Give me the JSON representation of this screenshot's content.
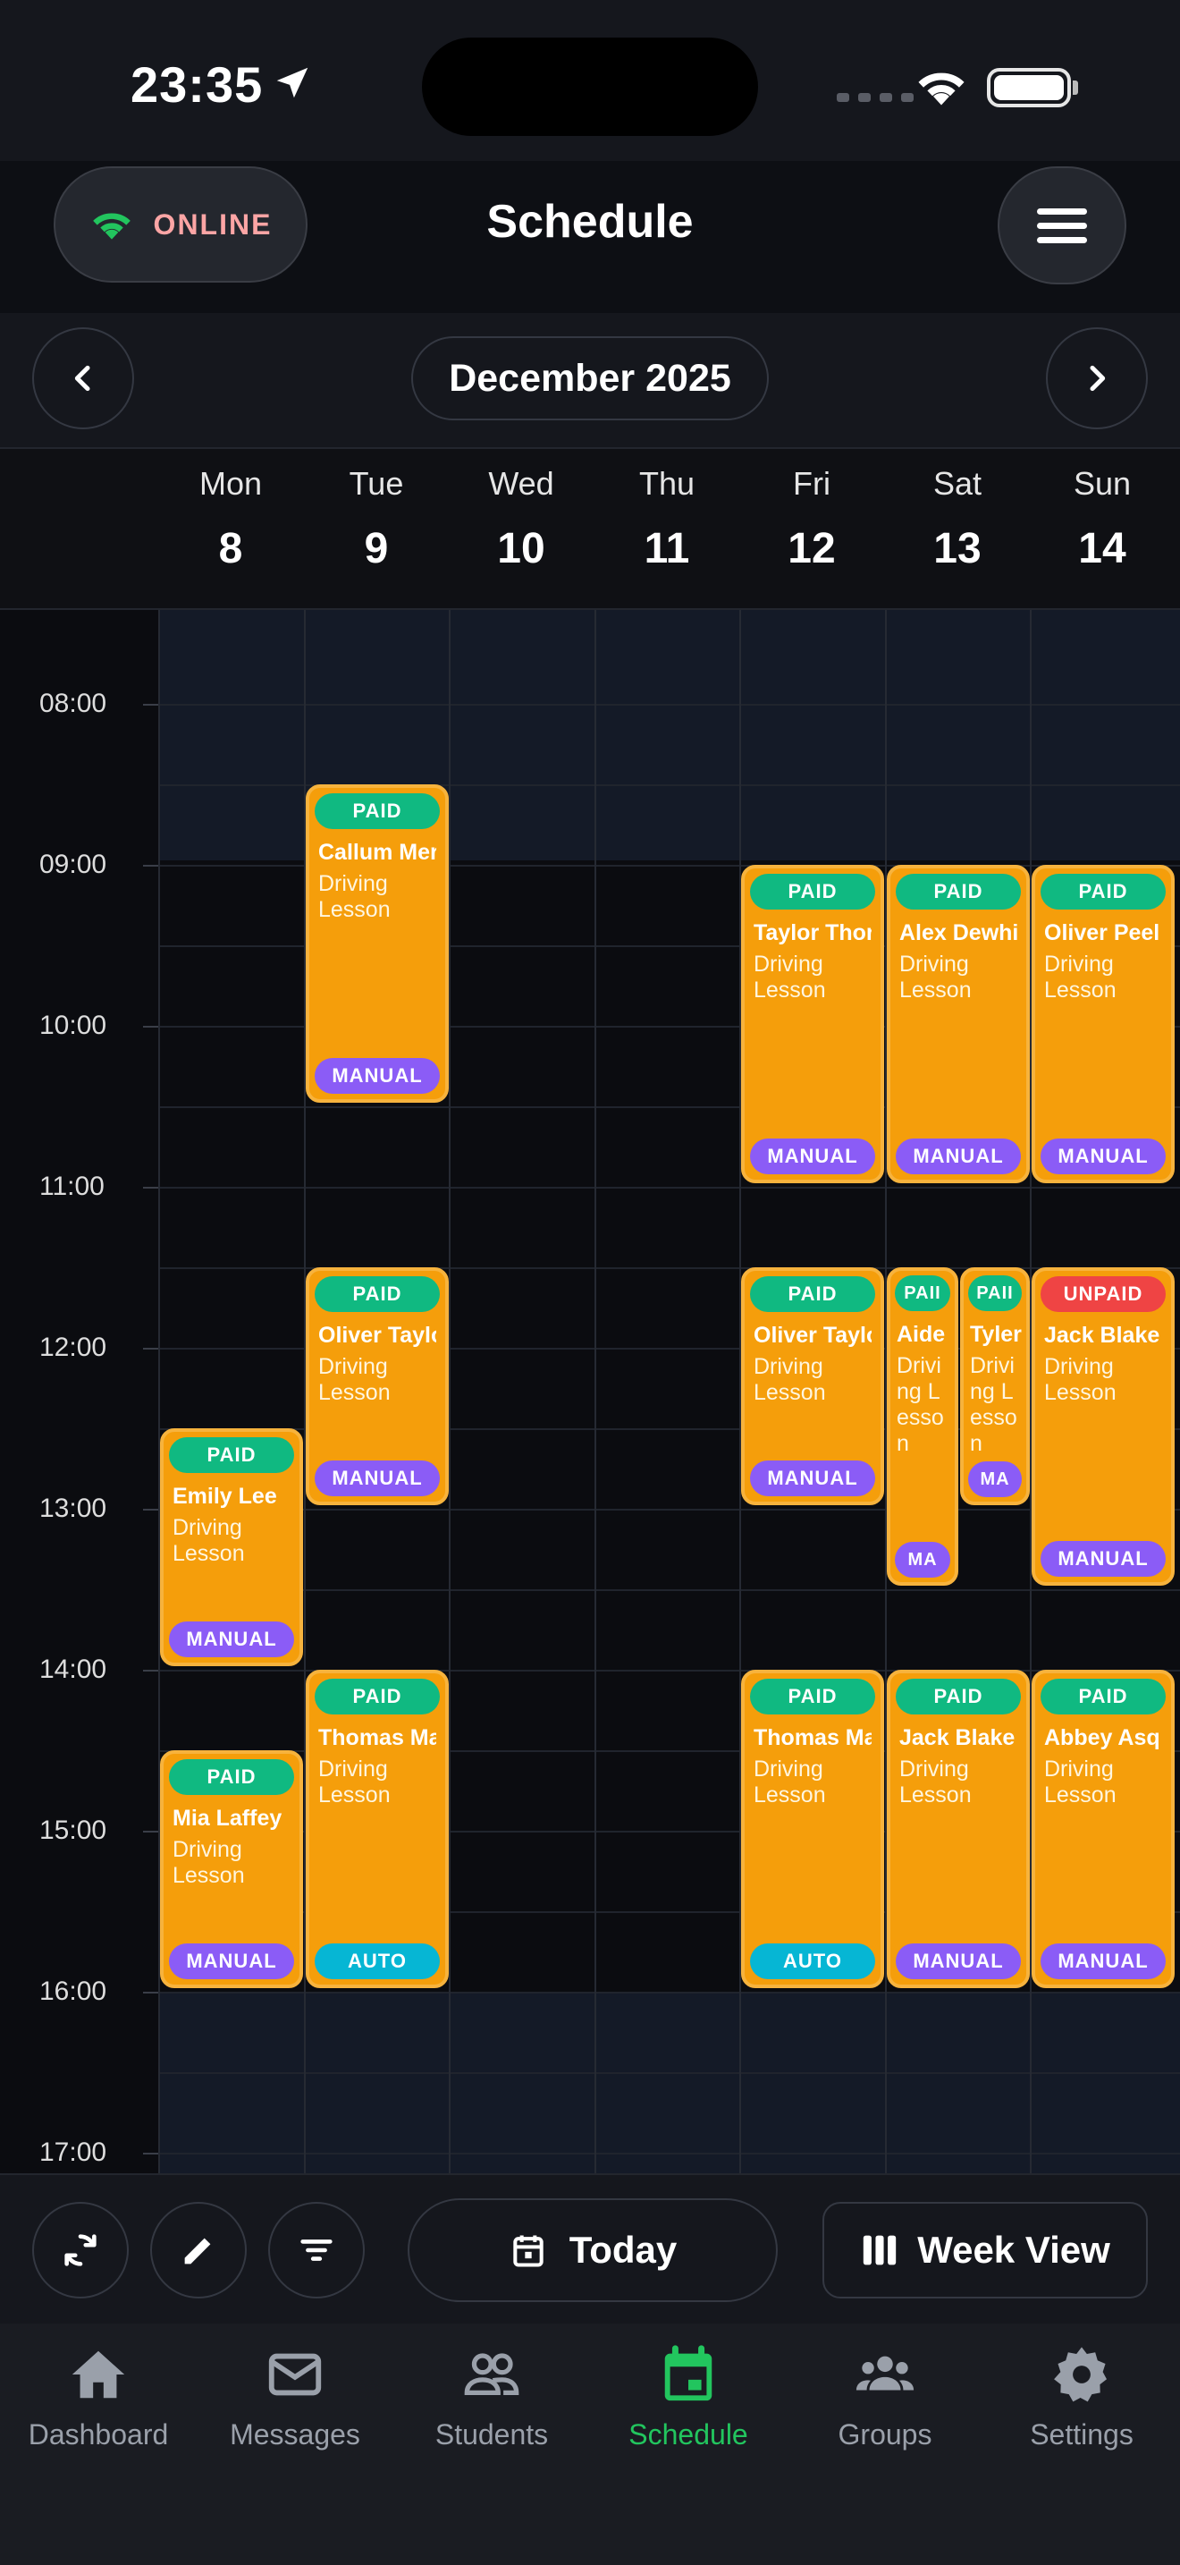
{
  "status_bar": {
    "time": "23:35"
  },
  "header": {
    "connection": "ONLINE",
    "title": "Schedule"
  },
  "month_nav": {
    "label": "December 2025"
  },
  "days": [
    {
      "name": "Mon",
      "num": "8"
    },
    {
      "name": "Tue",
      "num": "9"
    },
    {
      "name": "Wed",
      "num": "10"
    },
    {
      "name": "Thu",
      "num": "11"
    },
    {
      "name": "Fri",
      "num": "12"
    },
    {
      "name": "Sat",
      "num": "13"
    },
    {
      "name": "Sun",
      "num": "14"
    }
  ],
  "times": [
    "08:00",
    "09:00",
    "10:00",
    "11:00",
    "12:00",
    "13:00",
    "14:00",
    "15:00",
    "16:00",
    "17:00"
  ],
  "events": [
    {
      "name": "Callum Mer",
      "type": "Driving Lesson",
      "status": "PAID",
      "gear": "MANUAL"
    },
    {
      "name": "Taylor Thor",
      "type": "Driving Lesson",
      "status": "PAID",
      "gear": "MANUAL"
    },
    {
      "name": "Alex Dewhi",
      "type": "Driving Lesson",
      "status": "PAID",
      "gear": "MANUAL"
    },
    {
      "name": "Oliver Peel",
      "type": "Driving Lesson",
      "status": "PAID",
      "gear": "MANUAL"
    },
    {
      "name": "Oliver Taylo",
      "type": "Driving Lesson",
      "status": "PAID",
      "gear": "MANUAL"
    },
    {
      "name": "Oliver Taylo",
      "type": "Driving Lesson",
      "status": "PAID",
      "gear": "MANUAL"
    },
    {
      "name": "Aide",
      "type": "Driving Lesson",
      "status": "PAII",
      "gear": "MA"
    },
    {
      "name": "Tyler",
      "type": "Driving Lesson",
      "status": "PAII",
      "gear": "MA"
    },
    {
      "name": "Jack Blake",
      "type": "Driving Lesson",
      "status": "UNPAID",
      "gear": "MANUAL"
    },
    {
      "name": "Emily Lee",
      "type": "Driving Lesson",
      "status": "PAID",
      "gear": "MANUAL"
    },
    {
      "name": "Thomas Ma",
      "type": "Driving Lesson",
      "status": "PAID",
      "gear": "AUTO"
    },
    {
      "name": "Thomas Ma",
      "type": "Driving Lesson",
      "status": "PAID",
      "gear": "AUTO"
    },
    {
      "name": "Jack Blake",
      "type": "Driving Lesson",
      "status": "PAID",
      "gear": "MANUAL"
    },
    {
      "name": "Abbey Asq",
      "type": "Driving Lesson",
      "status": "PAID",
      "gear": "MANUAL"
    },
    {
      "name": "Mia Laffey",
      "type": "Driving Lesson",
      "status": "PAID",
      "gear": "MANUAL"
    }
  ],
  "toolbar": {
    "today": "Today",
    "view": "Week View"
  },
  "bottom_nav": [
    {
      "label": "Dashboard"
    },
    {
      "label": "Messages"
    },
    {
      "label": "Students"
    },
    {
      "label": "Schedule"
    },
    {
      "label": "Groups"
    },
    {
      "label": "Settings"
    }
  ]
}
